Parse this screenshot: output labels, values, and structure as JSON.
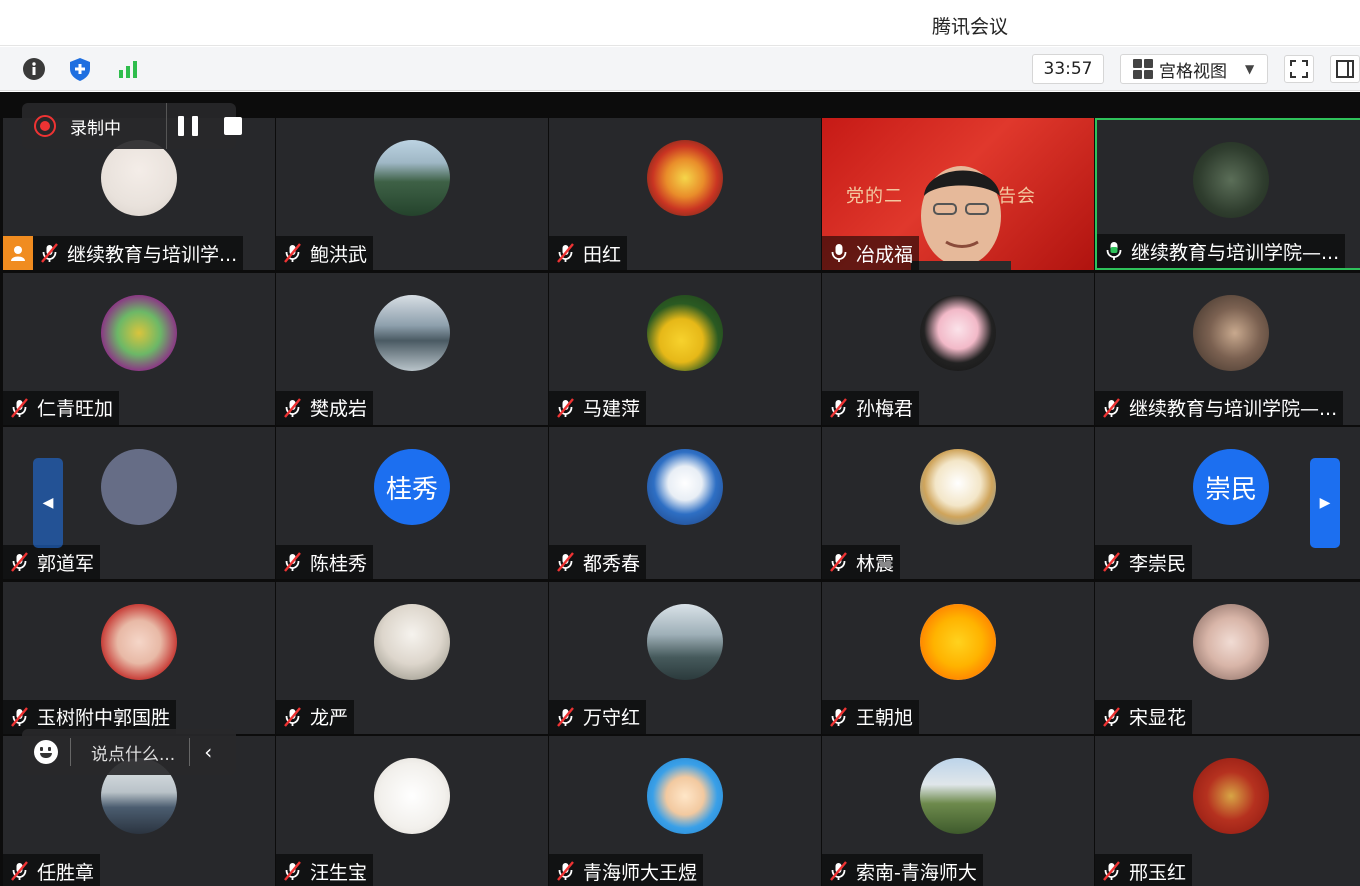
{
  "window": {
    "title": "腾讯会议"
  },
  "toolbar": {
    "icons": [
      "info-icon",
      "shield-icon",
      "signal-icon"
    ],
    "timer": "33:57",
    "view_label": "宫格视图",
    "view_caret": "▼"
  },
  "recording": {
    "label": "录制中"
  },
  "chat": {
    "placeholder": "说点什么..."
  },
  "participants": [
    {
      "name": "继续教育与培训学...",
      "mic": "muted",
      "host": true,
      "avatar": "photo-woman-bouquet"
    },
    {
      "name": "鲍洪武",
      "mic": "muted",
      "avatar": "photo-forest"
    },
    {
      "name": "田红",
      "mic": "muted",
      "avatar": "photo-cake"
    },
    {
      "name": "冶成福",
      "mic": "on",
      "video": true,
      "banner": "党的二　　　讲报告会"
    },
    {
      "name": "继续教育与培训学院—...",
      "mic": "speaking",
      "active": true,
      "avatar": "photo-bamboo"
    },
    {
      "name": "仁青旺加",
      "mic": "muted",
      "avatar": "photo-emblem"
    },
    {
      "name": "樊成岩",
      "mic": "muted",
      "avatar": "photo-river"
    },
    {
      "name": "马建萍",
      "mic": "muted",
      "avatar": "photo-flowers"
    },
    {
      "name": "孙梅君",
      "mic": "muted",
      "avatar": "photo-lotus"
    },
    {
      "name": "继续教育与培训学院—...",
      "mic": "muted",
      "avatar": "photo-man"
    },
    {
      "name": "郭道军",
      "mic": "muted",
      "avatar": "blank"
    },
    {
      "name": "陈桂秀",
      "mic": "muted",
      "initials": "桂秀"
    },
    {
      "name": "都秀春",
      "mic": "muted",
      "avatar": "photo-duck"
    },
    {
      "name": "林震",
      "mic": "muted",
      "avatar": "photo-cartoon"
    },
    {
      "name": "李崇民",
      "mic": "muted",
      "initials": "崇民"
    },
    {
      "name": "玉树附中郭国胜",
      "mic": "muted",
      "avatar": "photo-child"
    },
    {
      "name": "龙严",
      "mic": "muted",
      "avatar": "photo-bride"
    },
    {
      "name": "万守红",
      "mic": "muted",
      "avatar": "photo-lake"
    },
    {
      "name": "王朝旭",
      "mic": "muted",
      "avatar": "photo-sun"
    },
    {
      "name": "宋显花",
      "mic": "muted",
      "avatar": "photo-kids"
    },
    {
      "name": "任胜章",
      "mic": "muted",
      "avatar": "photo-car"
    },
    {
      "name": "汪生宝",
      "mic": "muted",
      "avatar": "photo-calligraphy"
    },
    {
      "name": "青海师大王煜",
      "mic": "muted",
      "avatar": "photo-cartoon-man"
    },
    {
      "name": "索南-青海师大",
      "mic": "muted",
      "avatar": "photo-grassland"
    },
    {
      "name": "邢玉红",
      "mic": "muted",
      "avatar": "photo-fu"
    }
  ],
  "colors": {
    "accent": "#1c6ff0",
    "active_border": "#2fc25b",
    "host_badge": "#f08c20",
    "tile_bg": "#27282b"
  }
}
